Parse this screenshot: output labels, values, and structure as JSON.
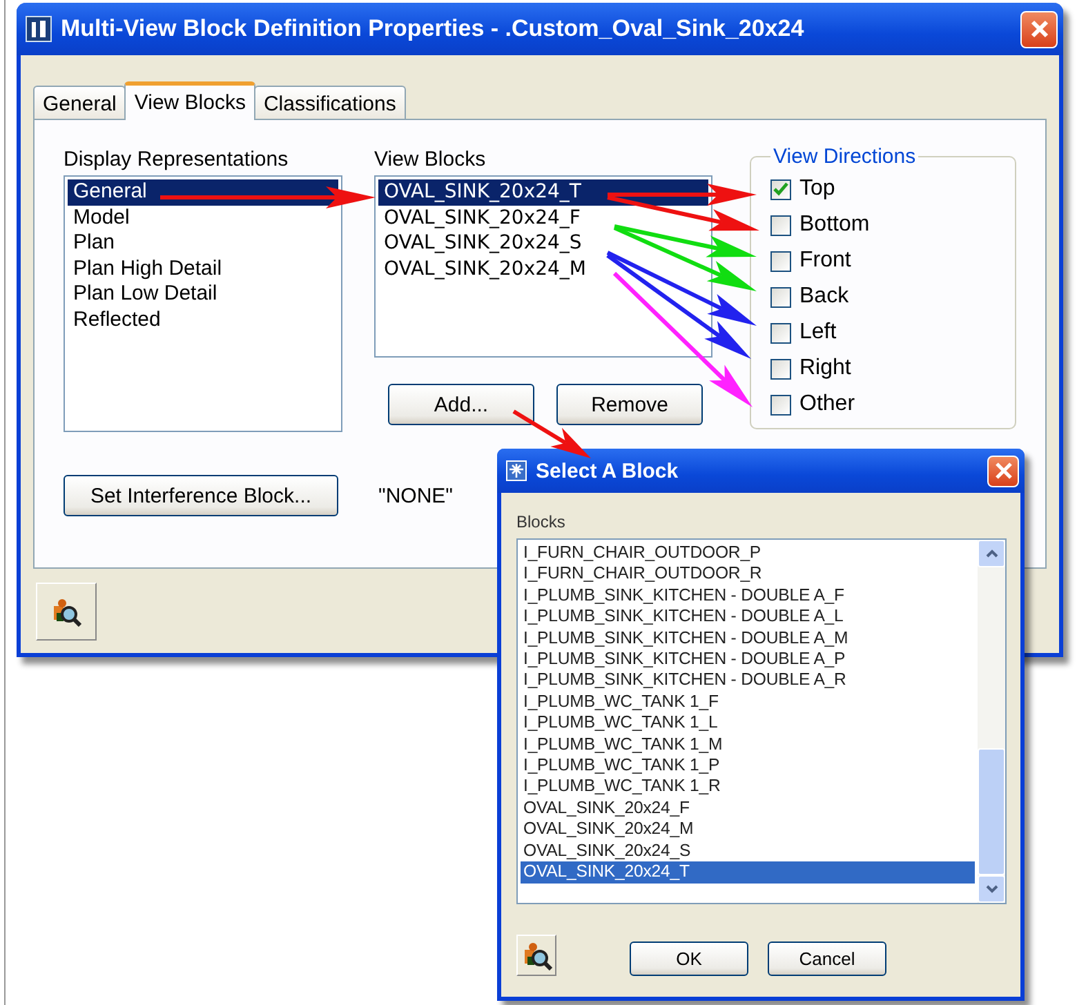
{
  "main_window": {
    "title": "Multi-View Block Definition Properties - .Custom_Oval_Sink_20x24",
    "tabs": [
      {
        "label": "General",
        "selected": false
      },
      {
        "label": "View Blocks",
        "selected": true
      },
      {
        "label": "Classifications",
        "selected": false
      }
    ],
    "display_representations": {
      "label": "Display Representations",
      "items": [
        {
          "label": "General",
          "selected": true
        },
        {
          "label": "Model",
          "selected": false
        },
        {
          "label": "Plan",
          "selected": false
        },
        {
          "label": "Plan High Detail",
          "selected": false
        },
        {
          "label": "Plan Low Detail",
          "selected": false
        },
        {
          "label": "Reflected",
          "selected": false
        }
      ]
    },
    "view_blocks": {
      "label": "View Blocks",
      "items": [
        {
          "label": "OVAL_SINK_20x24_T",
          "selected": true
        },
        {
          "label": "OVAL_SINK_20x24_F",
          "selected": false
        },
        {
          "label": "OVAL_SINK_20x24_S",
          "selected": false
        },
        {
          "label": "OVAL_SINK_20x24_M",
          "selected": false
        }
      ],
      "buttons": [
        "Add...",
        "Remove"
      ]
    },
    "view_directions": {
      "label": "View Directions",
      "items": [
        {
          "label": "Top",
          "checked": true
        },
        {
          "label": "Bottom",
          "checked": false
        },
        {
          "label": "Front",
          "checked": false
        },
        {
          "label": "Back",
          "checked": false
        },
        {
          "label": "Left",
          "checked": false
        },
        {
          "label": "Right",
          "checked": false
        },
        {
          "label": "Other",
          "checked": false
        }
      ]
    },
    "interference_button": "Set Interference Block...",
    "interference_value": "\"NONE\""
  },
  "select_dialog": {
    "title": "Select A Block",
    "label": "Blocks",
    "items": [
      {
        "label": "I_FURN_CHAIR_OUTDOOR_P",
        "selected": false
      },
      {
        "label": "I_FURN_CHAIR_OUTDOOR_R",
        "selected": false
      },
      {
        "label": "I_PLUMB_SINK_KITCHEN - DOUBLE A_F",
        "selected": false
      },
      {
        "label": "I_PLUMB_SINK_KITCHEN - DOUBLE A_L",
        "selected": false
      },
      {
        "label": "I_PLUMB_SINK_KITCHEN - DOUBLE A_M",
        "selected": false
      },
      {
        "label": "I_PLUMB_SINK_KITCHEN - DOUBLE A_P",
        "selected": false
      },
      {
        "label": "I_PLUMB_SINK_KITCHEN - DOUBLE A_R",
        "selected": false
      },
      {
        "label": "I_PLUMB_WC_TANK 1_F",
        "selected": false
      },
      {
        "label": "I_PLUMB_WC_TANK 1_L",
        "selected": false
      },
      {
        "label": "I_PLUMB_WC_TANK 1_M",
        "selected": false
      },
      {
        "label": "I_PLUMB_WC_TANK 1_P",
        "selected": false
      },
      {
        "label": "I_PLUMB_WC_TANK 1_R",
        "selected": false
      },
      {
        "label": "OVAL_SINK_20x24_F",
        "selected": false
      },
      {
        "label": "OVAL_SINK_20x24_M",
        "selected": false
      },
      {
        "label": "OVAL_SINK_20x24_S",
        "selected": false
      },
      {
        "label": "OVAL_SINK_20x24_T",
        "selected": true
      }
    ],
    "buttons": [
      "OK",
      "Cancel"
    ]
  }
}
